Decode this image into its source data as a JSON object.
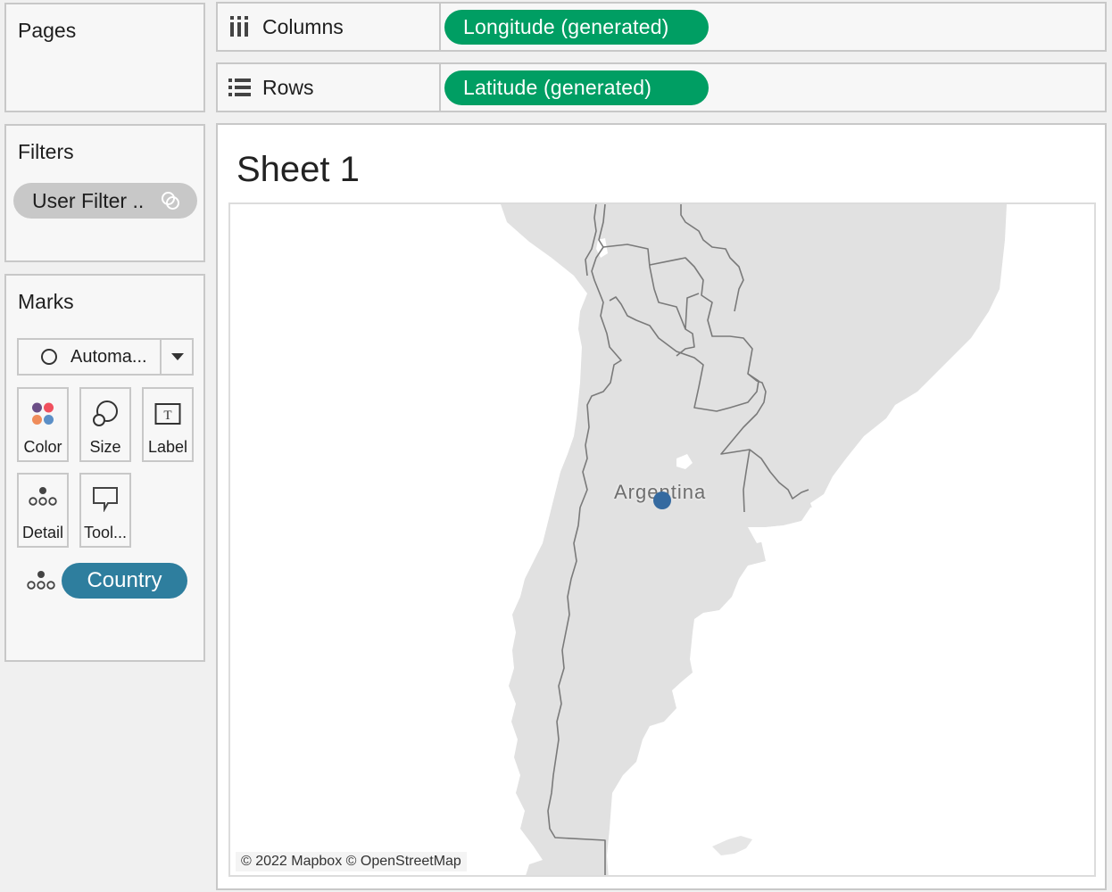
{
  "pages": {
    "title": "Pages"
  },
  "filters": {
    "title": "Filters",
    "items": [
      {
        "label": "User Filter ..",
        "icon": "linked-rings-icon"
      }
    ]
  },
  "marks": {
    "title": "Marks",
    "mark_type": {
      "label": "Automa...",
      "icon": "circle-outline-icon"
    },
    "buttons": [
      {
        "label": "Color",
        "icon": "color-dots-icon"
      },
      {
        "label": "Size",
        "icon": "size-circles-icon"
      },
      {
        "label": "Label",
        "icon": "text-label-icon"
      },
      {
        "label": "Detail",
        "icon": "detail-dots-icon"
      },
      {
        "label": "Tool...",
        "icon": "tooltip-bubble-icon"
      }
    ],
    "fields": [
      {
        "label": "Country",
        "role": "detail",
        "icon": "detail-dots-icon"
      }
    ],
    "color_swatches": [
      "#6b4e86",
      "#f0505e",
      "#ef8c5a",
      "#5b8fc7"
    ]
  },
  "shelves": {
    "columns": {
      "label": "Columns",
      "icon": "columns-icon",
      "pill": "Longitude (generated)"
    },
    "rows": {
      "label": "Rows",
      "icon": "rows-icon",
      "pill": "Latitude (generated)"
    }
  },
  "sheet": {
    "title": "Sheet 1",
    "map": {
      "attribution": "© 2022 Mapbox © OpenStreetMap",
      "points": [
        {
          "label": "Argentina",
          "color": "#356aa0"
        }
      ]
    }
  },
  "colors": {
    "field_pill": "#009e63",
    "dimension_pill": "#2e7e9e",
    "filter_pill": "#c8c8c8",
    "mark": "#356aa0",
    "land": "#e0e0e0",
    "border": "#7a7a7a"
  }
}
